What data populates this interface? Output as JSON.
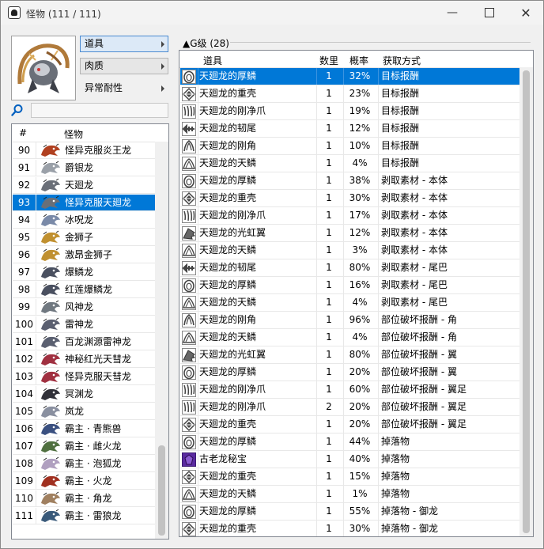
{
  "window": {
    "title": "怪物 (111 / 111)",
    "min_glyph": "—",
    "close_glyph": "✕"
  },
  "tabs": [
    {
      "label": "道具",
      "active": true
    },
    {
      "label": "肉质",
      "active": false
    },
    {
      "label": "异常耐性",
      "active": false
    }
  ],
  "search": {
    "placeholder": "",
    "value": ""
  },
  "monster_list": {
    "header_num": "#",
    "header_name": "怪物",
    "selected": "93",
    "rows": [
      {
        "num": "90",
        "name": "怪异克服炎王龙",
        "icon": "teostra-icon"
      },
      {
        "num": "91",
        "name": "爵银龙",
        "icon": "silver-dragon-icon"
      },
      {
        "num": "92",
        "name": "天廻龙",
        "icon": "shagaru-icon"
      },
      {
        "num": "93",
        "name": "怪异克服天廻龙",
        "icon": "shagaru-icon"
      },
      {
        "num": "94",
        "name": "冰呪龙",
        "icon": "ice-dragon-icon"
      },
      {
        "num": "95",
        "name": "金狮子",
        "icon": "rajang-icon"
      },
      {
        "num": "96",
        "name": "激昂金狮子",
        "icon": "rajang-icon"
      },
      {
        "num": "97",
        "name": "爆鳞龙",
        "icon": "bazel-icon"
      },
      {
        "num": "98",
        "name": "红莲爆鳞龙",
        "icon": "bazel-icon"
      },
      {
        "num": "99",
        "name": "风神龙",
        "icon": "kushala-icon"
      },
      {
        "num": "100",
        "name": "雷神龙",
        "icon": "thunder-god-icon"
      },
      {
        "num": "101",
        "name": "百龙渊源雷神龙",
        "icon": "thunder-god-icon"
      },
      {
        "num": "102",
        "name": "神秘红光天彗龙",
        "icon": "valstrax-icon"
      },
      {
        "num": "103",
        "name": "怪异克服天彗龙",
        "icon": "valstrax-icon"
      },
      {
        "num": "104",
        "name": "冥渊龙",
        "icon": "gaismagorm-icon"
      },
      {
        "num": "105",
        "name": "岚龙",
        "icon": "amatsu-icon"
      },
      {
        "num": "106",
        "name": "霸主 · 青熊兽",
        "icon": "arzuros-icon"
      },
      {
        "num": "107",
        "name": "霸主 · 雌火龙",
        "icon": "rathian-icon"
      },
      {
        "num": "108",
        "name": "霸主 · 泡狐龙",
        "icon": "mizutsune-icon"
      },
      {
        "num": "109",
        "name": "霸主 · 火龙",
        "icon": "rathalos-icon"
      },
      {
        "num": "110",
        "name": "霸主 · 角龙",
        "icon": "diablos-icon"
      },
      {
        "num": "111",
        "name": "霸主 · 雷狼龙",
        "icon": "zinogre-icon"
      }
    ]
  },
  "items": {
    "group_label": "▲G级 (28)",
    "headers": {
      "name": "道具",
      "qty": "数里",
      "rate": "概率",
      "method": "获取方式"
    },
    "rows": [
      {
        "icon": "scale",
        "name": "天廻龙的厚鳞",
        "qty": "1",
        "rate": "32%",
        "method": "目标报酬",
        "selected": true
      },
      {
        "icon": "shell",
        "name": "天廻龙的重壳",
        "qty": "1",
        "rate": "23%",
        "method": "目标报酬"
      },
      {
        "icon": "claw",
        "name": "天廻龙的刚净爪",
        "qty": "1",
        "rate": "19%",
        "method": "目标报酬"
      },
      {
        "icon": "tail",
        "name": "天廻龙的韧尾",
        "qty": "1",
        "rate": "12%",
        "method": "目标报酬"
      },
      {
        "icon": "horn",
        "name": "天廻龙的刚角",
        "qty": "1",
        "rate": "10%",
        "method": "目标报酬"
      },
      {
        "icon": "mantle",
        "name": "天廻龙的天鳞",
        "qty": "1",
        "rate": "4%",
        "method": "目标报酬"
      },
      {
        "icon": "scale",
        "name": "天廻龙的厚鳞",
        "qty": "1",
        "rate": "38%",
        "method": "剥取素材 - 本体"
      },
      {
        "icon": "shell",
        "name": "天廻龙的重壳",
        "qty": "1",
        "rate": "30%",
        "method": "剥取素材 - 本体"
      },
      {
        "icon": "claw",
        "name": "天廻龙的刚净爪",
        "qty": "1",
        "rate": "17%",
        "method": "剥取素材 - 本体"
      },
      {
        "icon": "wing",
        "name": "天廻龙的光虹翼",
        "qty": "1",
        "rate": "12%",
        "method": "剥取素材 - 本体"
      },
      {
        "icon": "mantle",
        "name": "天廻龙的天鳞",
        "qty": "1",
        "rate": "3%",
        "method": "剥取素材 - 本体"
      },
      {
        "icon": "tail",
        "name": "天廻龙的韧尾",
        "qty": "1",
        "rate": "80%",
        "method": "剥取素材 - 尾巴"
      },
      {
        "icon": "scale",
        "name": "天廻龙的厚鳞",
        "qty": "1",
        "rate": "16%",
        "method": "剥取素材 - 尾巴"
      },
      {
        "icon": "mantle",
        "name": "天廻龙的天鳞",
        "qty": "1",
        "rate": "4%",
        "method": "剥取素材 - 尾巴"
      },
      {
        "icon": "horn",
        "name": "天廻龙的刚角",
        "qty": "1",
        "rate": "96%",
        "method": "部位破坏报酬 - 角"
      },
      {
        "icon": "mantle",
        "name": "天廻龙的天鳞",
        "qty": "1",
        "rate": "4%",
        "method": "部位破坏报酬 - 角"
      },
      {
        "icon": "wing",
        "name": "天廻龙的光虹翼",
        "qty": "1",
        "rate": "80%",
        "method": "部位破坏报酬 - 翼"
      },
      {
        "icon": "scale",
        "name": "天廻龙的厚鳞",
        "qty": "1",
        "rate": "20%",
        "method": "部位破坏报酬 - 翼"
      },
      {
        "icon": "claw",
        "name": "天廻龙的刚净爪",
        "qty": "1",
        "rate": "60%",
        "method": "部位破坏报酬 - 翼足"
      },
      {
        "icon": "claw",
        "name": "天廻龙的刚净爪",
        "qty": "2",
        "rate": "20%",
        "method": "部位破坏报酬 - 翼足"
      },
      {
        "icon": "shell",
        "name": "天廻龙的重壳",
        "qty": "1",
        "rate": "20%",
        "method": "部位破坏报酬 - 翼足"
      },
      {
        "icon": "scale",
        "name": "天廻龙的厚鳞",
        "qty": "1",
        "rate": "44%",
        "method": "掉落物"
      },
      {
        "icon": "gem",
        "name": "古老龙秘宝",
        "qty": "1",
        "rate": "40%",
        "method": "掉落物"
      },
      {
        "icon": "shell",
        "name": "天廻龙的重壳",
        "qty": "1",
        "rate": "15%",
        "method": "掉落物"
      },
      {
        "icon": "mantle",
        "name": "天廻龙的天鳞",
        "qty": "1",
        "rate": "1%",
        "method": "掉落物"
      },
      {
        "icon": "scale",
        "name": "天廻龙的厚鳞",
        "qty": "1",
        "rate": "55%",
        "method": "掉落物 - 御龙"
      },
      {
        "icon": "shell",
        "name": "天廻龙的重壳",
        "qty": "1",
        "rate": "30%",
        "method": "掉落物 - 御龙"
      }
    ]
  },
  "colors": {
    "selection": "#0078d7",
    "gem": "#5a2aa0",
    "icon_gray": "#555555"
  }
}
